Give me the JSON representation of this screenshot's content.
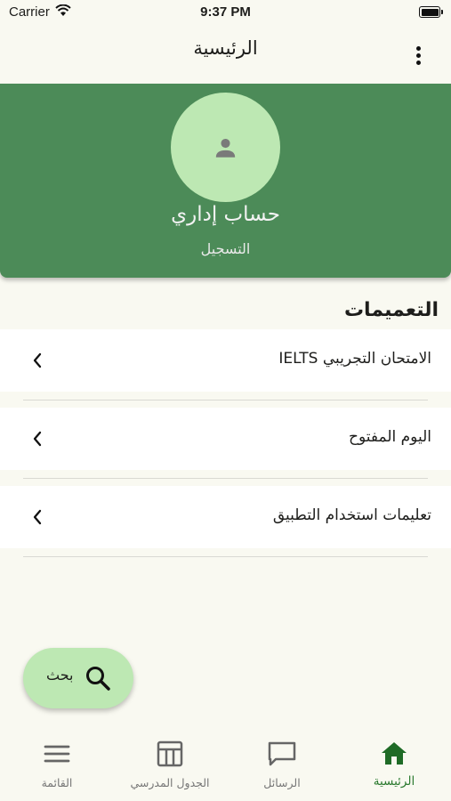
{
  "status_bar": {
    "carrier": "Carrier",
    "time": "9:37 PM"
  },
  "app_bar": {
    "title": "الرئيسية"
  },
  "profile": {
    "account_name": "حساب  إداري",
    "register_label": "التسجيل"
  },
  "section": {
    "title": "التعميمات"
  },
  "announcements": [
    {
      "label": "الامتحان التجريبي IELTS"
    },
    {
      "label": "اليوم المفتوح"
    },
    {
      "label": "تعليمات استخدام التطبيق"
    }
  ],
  "fab": {
    "label": "بحث"
  },
  "bottom_nav": {
    "home": "الرئيسية",
    "messages": "الرسائل",
    "schedule": "الجدول المدرسي",
    "menu": "القائمة"
  },
  "colors": {
    "header": "#4c8b58",
    "accent_light": "#bde8b3",
    "active_nav": "#2c7a30"
  }
}
